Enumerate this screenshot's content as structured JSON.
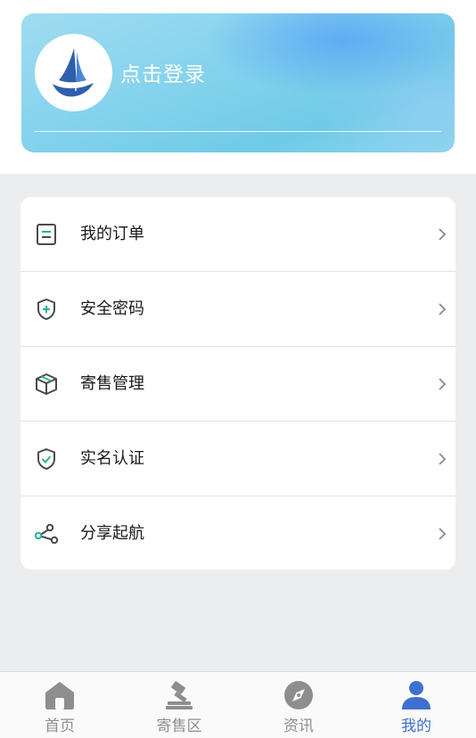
{
  "profile": {
    "login_label": "点击登录"
  },
  "menu": {
    "items": [
      {
        "label": "我的订单",
        "icon": "order-icon"
      },
      {
        "label": "安全密码",
        "icon": "shield-plus-icon"
      },
      {
        "label": "寄售管理",
        "icon": "box-icon"
      },
      {
        "label": "实名认证",
        "icon": "shield-check-icon"
      },
      {
        "label": "分享起航",
        "icon": "share-icon"
      }
    ]
  },
  "tabbar": {
    "tabs": [
      {
        "label": "首页",
        "icon": "home-icon",
        "active": false
      },
      {
        "label": "寄售区",
        "icon": "gavel-icon",
        "active": false
      },
      {
        "label": "资讯",
        "icon": "compass-icon",
        "active": false
      },
      {
        "label": "我的",
        "icon": "user-icon",
        "active": true
      }
    ]
  },
  "colors": {
    "accent": "#3f6fd0",
    "icon_teal": "#27b39a",
    "icon_gray": "#4a4a4a",
    "inactive": "#8e8e8e"
  }
}
